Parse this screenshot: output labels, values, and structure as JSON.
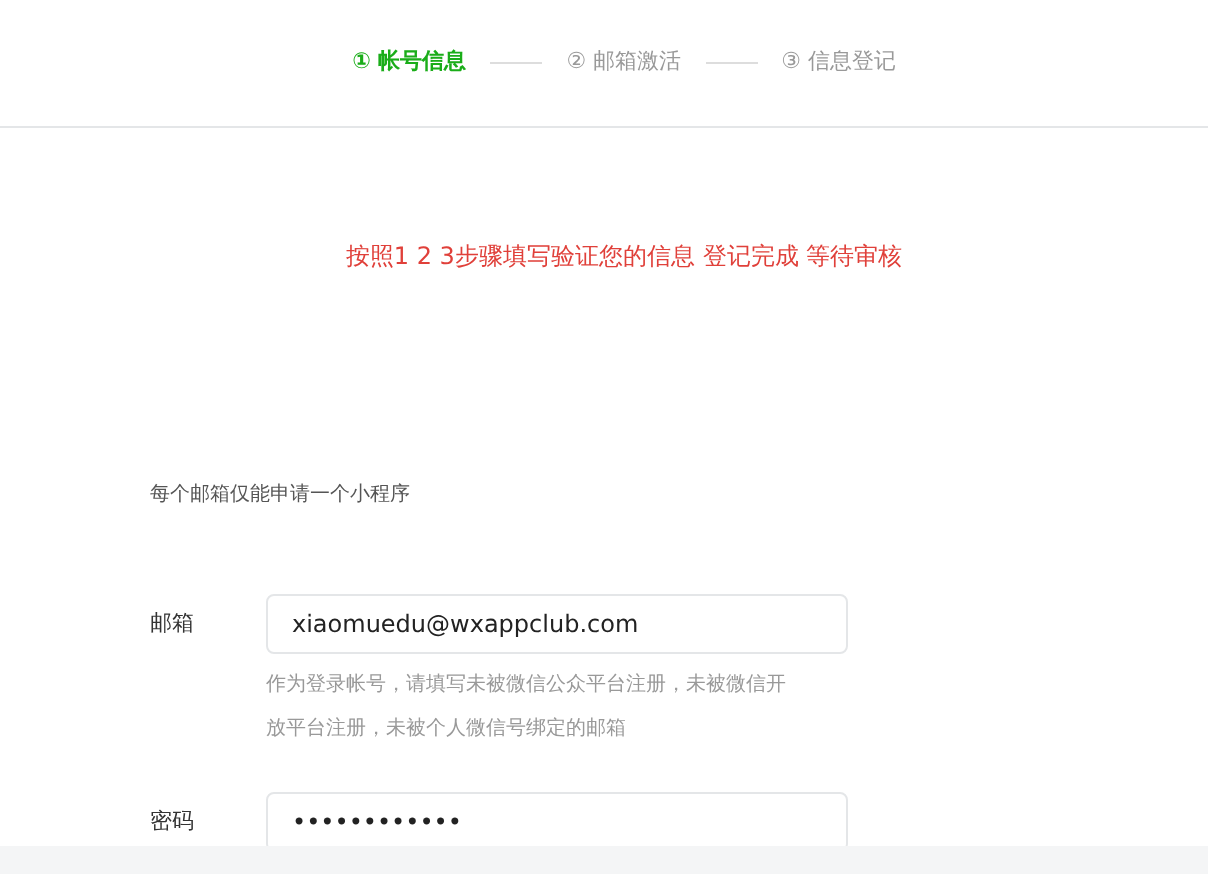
{
  "steps": [
    {
      "label": "① 帐号信息",
      "selected": true
    },
    {
      "label": "② 邮箱激活",
      "selected": false
    },
    {
      "label": "③ 信息登记",
      "selected": false
    }
  ],
  "notice": "按照1 2 3步骤填写验证您的信息 登记完成 等待审核",
  "intro": "每个邮箱仅能申请一个小程序",
  "fields": [
    {
      "label": "邮箱",
      "value": "xiaomuedu@wxappclub.com",
      "hint": "作为登录帐号，请填写未被微信公众平台注册，未被微信开放平台注册，未被个人微信号绑定的邮箱"
    },
    {
      "label": "密码",
      "value": "••••••••••••"
    }
  ]
}
